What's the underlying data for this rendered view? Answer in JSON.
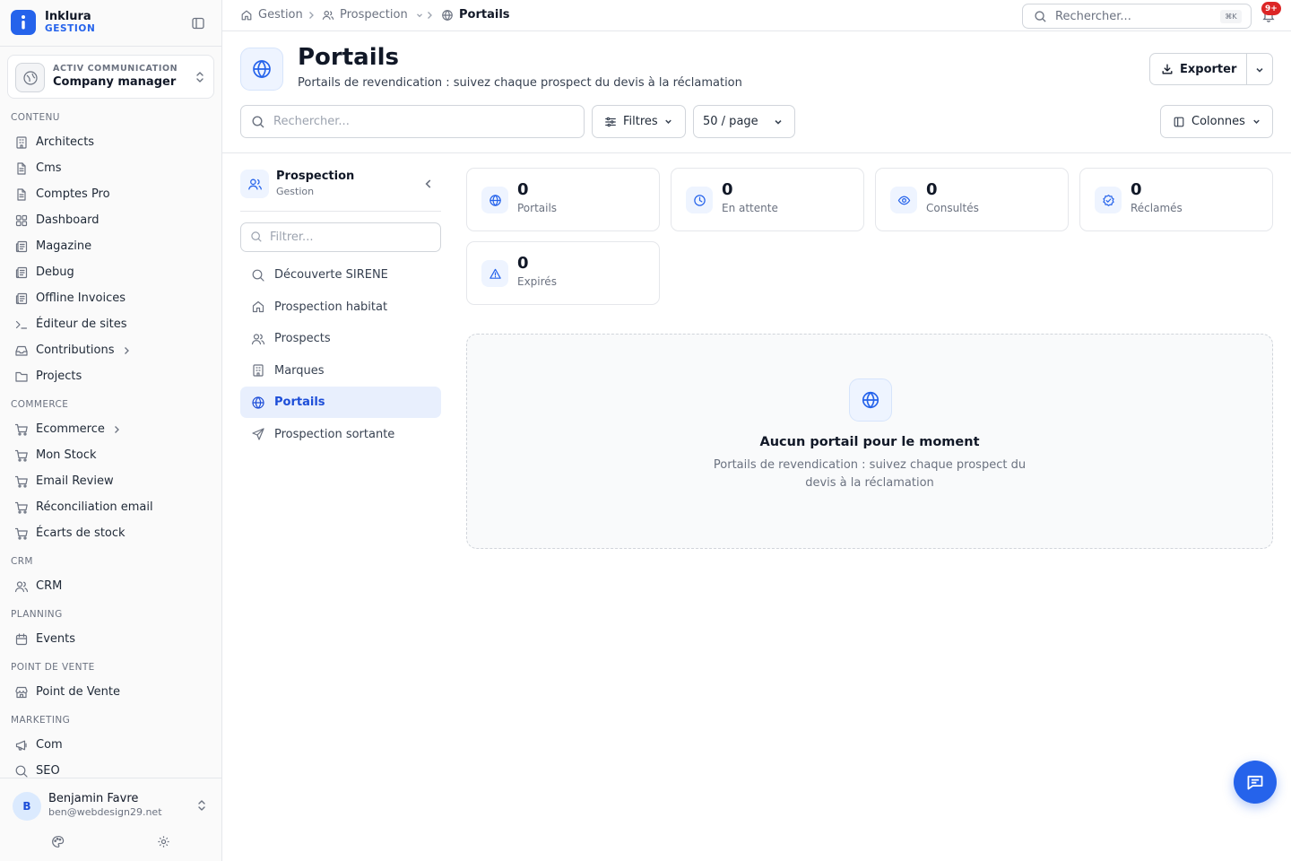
{
  "brand": {
    "name": "Inklura",
    "sub": "GESTION"
  },
  "company": {
    "kicker": "ACTIV COMMUNICATION",
    "name": "Company manager"
  },
  "nav": {
    "sections": [
      {
        "title": "CONTENU",
        "items": [
          {
            "label": "Architects",
            "icon": "building-icon"
          },
          {
            "label": "Cms",
            "icon": "file-icon"
          },
          {
            "label": "Comptes Pro",
            "icon": "file-icon"
          },
          {
            "label": "Dashboard",
            "icon": "grid-icon"
          },
          {
            "label": "Magazine",
            "icon": "newspaper-icon"
          },
          {
            "label": "Debug",
            "icon": "newspaper-icon"
          },
          {
            "label": "Offline Invoices",
            "icon": "newspaper-icon"
          },
          {
            "label": "Éditeur de sites",
            "icon": "terminal-icon"
          },
          {
            "label": "Contributions",
            "icon": "inbox-icon"
          },
          {
            "label": "Projects",
            "icon": "folder-icon"
          }
        ]
      },
      {
        "title": "COMMERCE",
        "items": [
          {
            "label": "Ecommerce",
            "icon": "cart-icon"
          },
          {
            "label": "Mon Stock",
            "icon": "cart-icon"
          },
          {
            "label": "Email Review",
            "icon": "cart-icon"
          },
          {
            "label": "Réconciliation email",
            "icon": "cart-icon"
          },
          {
            "label": "Écarts de stock",
            "icon": "cart-icon"
          }
        ]
      },
      {
        "title": "CRM",
        "items": [
          {
            "label": "CRM",
            "icon": "users-icon"
          }
        ]
      },
      {
        "title": "PLANNING",
        "items": [
          {
            "label": "Events",
            "icon": "calendar-icon"
          }
        ]
      },
      {
        "title": "POINT DE VENTE",
        "items": [
          {
            "label": "Point de Vente",
            "icon": "store-icon"
          }
        ]
      },
      {
        "title": "MARKETING",
        "items": [
          {
            "label": "Com",
            "icon": "megaphone-icon"
          },
          {
            "label": "SEO",
            "icon": "search-icon"
          }
        ]
      }
    ]
  },
  "user": {
    "initial": "B",
    "name": "Benjamin Favre",
    "email": "ben@webdesign29.net"
  },
  "breadcrumb": {
    "home": "Gestion",
    "section": "Prospection",
    "current": "Portails"
  },
  "topbar": {
    "search_placeholder": "Rechercher...",
    "shortcut": "⌘K",
    "notif_count": "9+"
  },
  "header": {
    "title": "Portails",
    "subtitle": "Portails de revendication : suivez chaque prospect du devis à la réclamation",
    "export_label": "Exporter"
  },
  "toolbar": {
    "search_placeholder": "Rechercher...",
    "filters_label": "Filtres",
    "per_page_label": "50 / page",
    "columns_label": "Colonnes"
  },
  "subnav": {
    "title": "Prospection",
    "subtitle": "Gestion",
    "filter_placeholder": "Filtrer...",
    "items": [
      {
        "label": "Découverte SIRENE",
        "icon": "search-icon"
      },
      {
        "label": "Prospection habitat",
        "icon": "home-icon"
      },
      {
        "label": "Prospects",
        "icon": "users-icon"
      },
      {
        "label": "Marques",
        "icon": "building-icon"
      },
      {
        "label": "Portails",
        "icon": "globe-icon"
      },
      {
        "label": "Prospection sortante",
        "icon": "send-icon"
      }
    ]
  },
  "stats": [
    {
      "value": "0",
      "label": "Portails",
      "icon": "globe-icon"
    },
    {
      "value": "0",
      "label": "En attente",
      "icon": "clock-icon"
    },
    {
      "value": "0",
      "label": "Consultés",
      "icon": "eye-icon"
    },
    {
      "value": "0",
      "label": "Réclamés",
      "icon": "check-badge-icon"
    },
    {
      "value": "0",
      "label": "Expirés",
      "icon": "warning-icon"
    }
  ],
  "empty": {
    "title": "Aucun portail pour le moment",
    "text": "Portails de revendication : suivez chaque prospect du devis à la réclamation"
  },
  "colors": {
    "accent": "#2563eb",
    "accent_soft": "#e8effd",
    "badge": "#dc2626"
  }
}
